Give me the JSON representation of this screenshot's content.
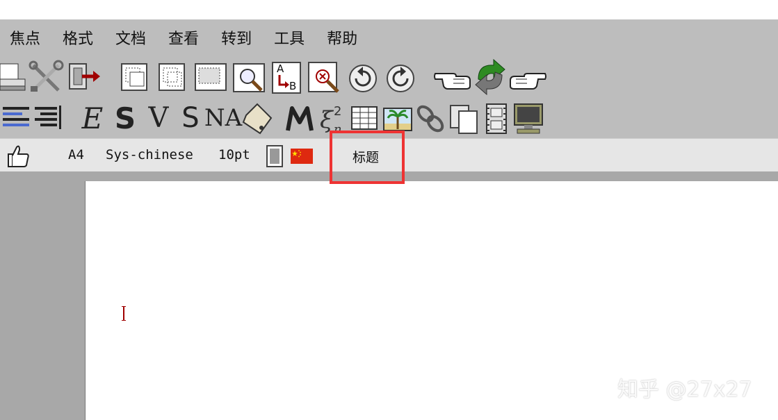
{
  "menubar": {
    "items": [
      {
        "label": "焦点"
      },
      {
        "label": "格式"
      },
      {
        "label": "文档"
      },
      {
        "label": "查看"
      },
      {
        "label": "转到"
      },
      {
        "label": "工具"
      },
      {
        "label": "帮助"
      }
    ]
  },
  "toolbar1": {
    "icons": [
      "printer-icon",
      "preferences-tools-icon",
      "quit-icon",
      "copy-icon",
      "cut-icon",
      "paste-icon",
      "search-icon",
      "replace-icon",
      "spell-check-icon",
      "undo-icon",
      "redo-icon",
      "hand-point-left-icon",
      "refresh-icon",
      "hand-point-right-icon"
    ],
    "replace_letters": {
      "top": "A",
      "bottom": "B"
    }
  },
  "toolbar2": {
    "style_labels": {
      "emphasize": "E",
      "strong": "S",
      "verbatim": "V",
      "sans": "S",
      "small_caps": "NA"
    },
    "math_sup": "2",
    "colors": {
      "palm_green": "#2a8a2a",
      "refresh_green": "#2e8b22"
    }
  },
  "statusbar": {
    "paper": "A4",
    "language_font": "Sys-chinese",
    "font_size": "10pt",
    "tag": "标题"
  },
  "watermark": "知乎 @27x27",
  "colors": {
    "toolbar_bg": "#bdbdbd",
    "highlight": "#ee3333",
    "cursor": "#a00000",
    "flag_red": "#de2910"
  }
}
